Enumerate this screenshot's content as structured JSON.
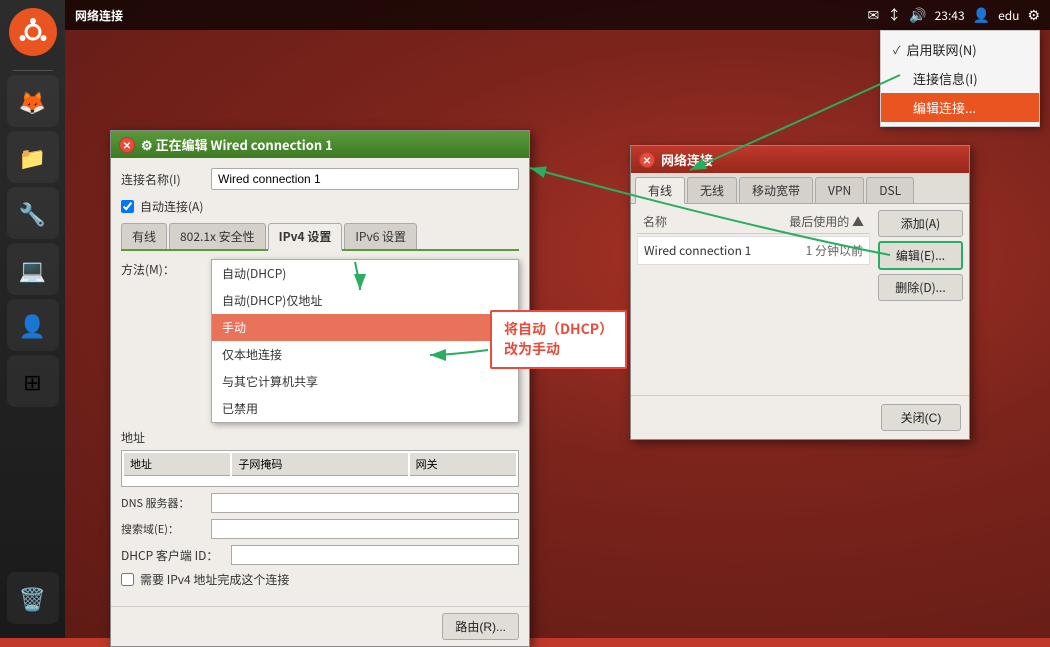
{
  "desktop": {
    "title": "网络连接"
  },
  "top_panel": {
    "title": "网络连接",
    "time": "23:43",
    "user": "edu"
  },
  "sys_tray": {
    "items": [
      {
        "label": "启用联网(N)",
        "checked": true,
        "active": false
      },
      {
        "label": "连接信息(I)",
        "checked": false,
        "active": false
      },
      {
        "label": "编辑连接...",
        "checked": false,
        "active": true
      }
    ]
  },
  "net_dialog": {
    "title": "网络连接",
    "tabs": [
      "有线",
      "无线",
      "移动宽带",
      "VPN",
      "DSL"
    ],
    "active_tab": "有线",
    "table": {
      "headers": [
        "名称",
        "最后使用的 ▲"
      ],
      "rows": [
        {
          "name": "Wired connection 1",
          "time": "1 分钟以前"
        }
      ]
    },
    "buttons": {
      "add": "添加(A)",
      "edit": "编辑(E)...",
      "delete": "删除(D)..."
    },
    "footer": {
      "close": "关闭(C)"
    }
  },
  "edit_dialog": {
    "title": "正在编辑 Wired connection 1",
    "conn_name_label": "连接名称(I)",
    "conn_name_value": "Wired connection 1",
    "auto_connect_label": "自动连接(A)",
    "auto_connect_checked": true,
    "tabs": [
      "有线",
      "802.1x 安全性",
      "IPv4 设置",
      "IPv6 设置"
    ],
    "active_tab": "IPv4 设置",
    "method_label": "方法(M)：",
    "method_options": [
      {
        "label": "自动(DHCP)",
        "selected": false
      },
      {
        "label": "自动(DHCP)仅地址",
        "selected": false
      },
      {
        "label": "手动",
        "selected": true
      },
      {
        "label": "仅本地连接",
        "selected": false
      },
      {
        "label": "与其它计算机共享",
        "selected": false
      },
      {
        "label": "已禁用",
        "selected": false
      }
    ],
    "address_label": "地址",
    "address_cols": [
      "地址",
      "子网掩码",
      "网关"
    ],
    "dns_label": "DNS 服务器：",
    "search_label": "搜索域(E)：",
    "dhcp_label": "DHCP 客户端 ID：",
    "checkbox_label": "需要 IPv4 地址完成这个连接",
    "route_btn": "路由(R)..."
  },
  "annotation": {
    "line1": "将自动（DHCP）",
    "line2": "改为手动"
  },
  "taskbar": {
    "items": [
      "🐧",
      "🦊",
      "👤",
      "🔧",
      "💻",
      "📁",
      "🗑️"
    ]
  }
}
